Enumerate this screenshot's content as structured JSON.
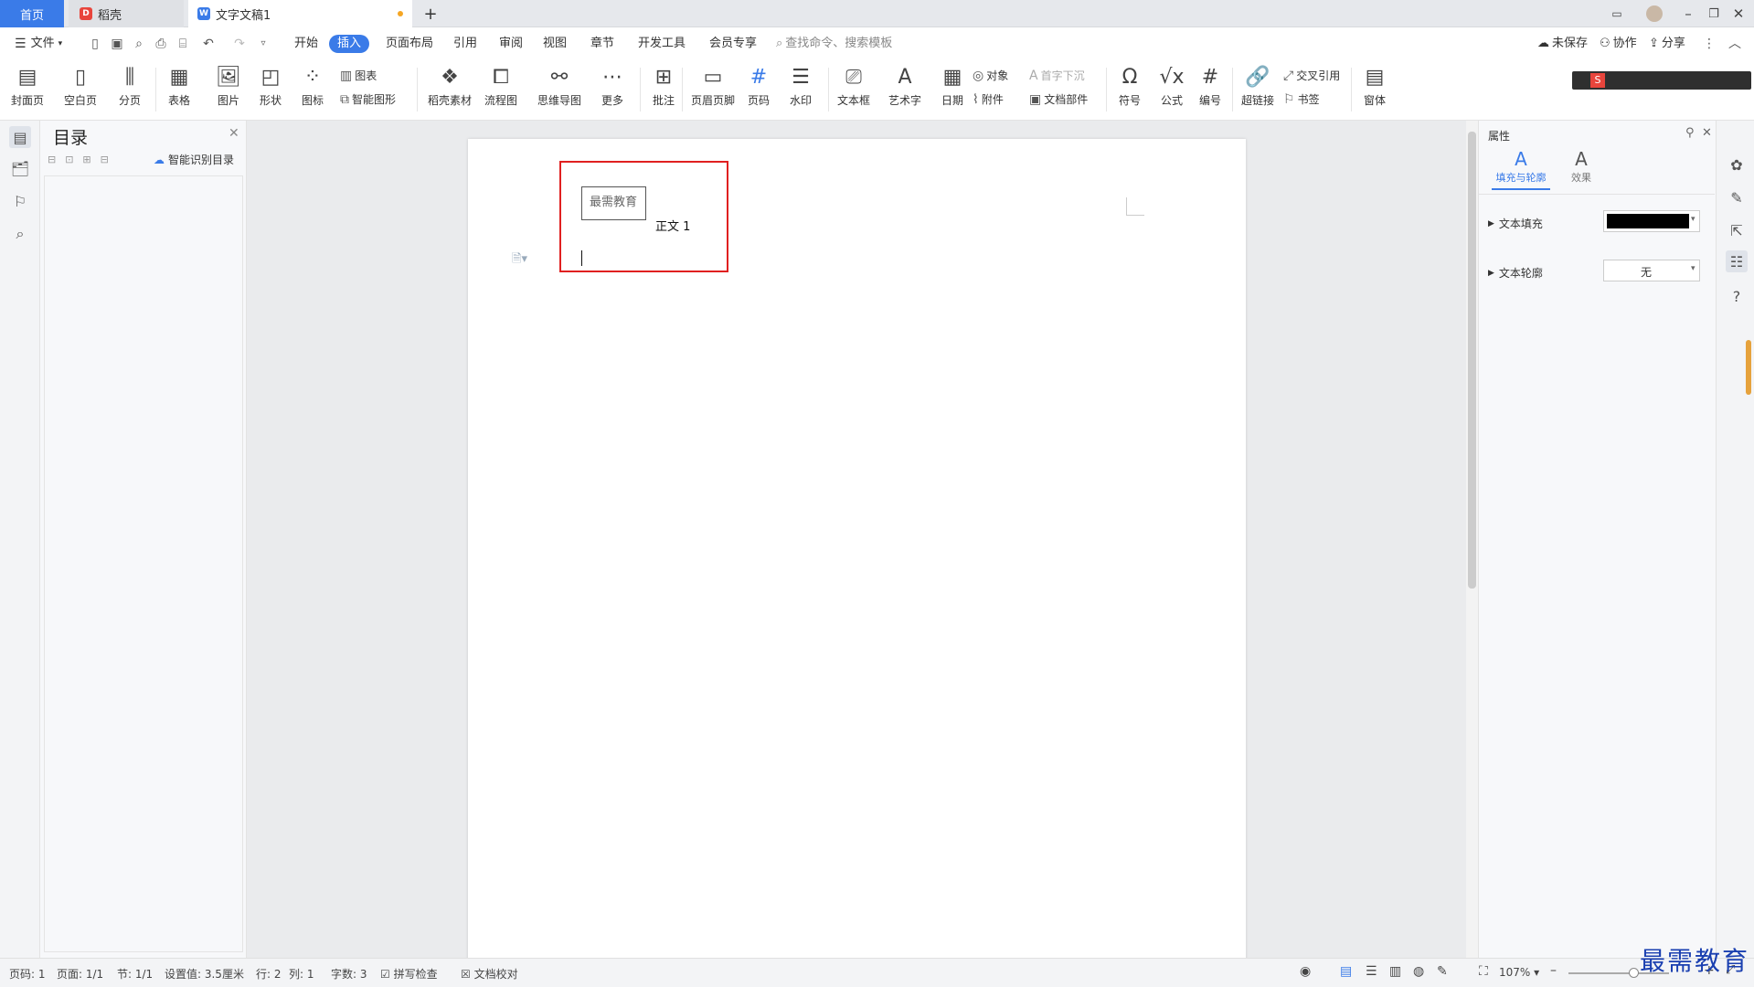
{
  "tabs": {
    "home": "首页",
    "docer": "稻壳",
    "doc": "文字文稿1",
    "add": "+"
  },
  "menu": {
    "file": "文件",
    "items": [
      "开始",
      "插入",
      "页面布局",
      "引用",
      "审阅",
      "视图",
      "章节",
      "开发工具",
      "会员专享"
    ],
    "active_index": 1,
    "search_placeholder": "查找命令、搜索模板",
    "unsaved": "未保存",
    "collab": "协作",
    "share": "分享"
  },
  "ribbon": {
    "cover": "封面页",
    "blank": "空白页",
    "pagebreak": "分页",
    "table": "表格",
    "picture": "图片",
    "shape": "形状",
    "icon": "图标",
    "chart": "图表",
    "smartart": "智能图形",
    "docer_material": "稻壳素材",
    "flowchart": "流程图",
    "mindmap": "思维导图",
    "more": "更多",
    "comment": "批注",
    "header_footer": "页眉页脚",
    "page_number": "页码",
    "watermark": "水印",
    "textbox": "文本框",
    "wordart": "艺术字",
    "date": "日期",
    "object": "对象",
    "attachment": "附件",
    "dropcap": "首字下沉",
    "doc_parts": "文档部件",
    "symbol": "符号",
    "formula": "公式",
    "numbering": "编号",
    "hyperlink": "超链接",
    "crossref": "交叉引用",
    "bookmark": "书签",
    "window": "窗体"
  },
  "toc": {
    "title": "目录",
    "smart": "智能识别目录"
  },
  "document": {
    "textbox_text": "最需教育",
    "body_text": "正文 1"
  },
  "properties": {
    "title": "属性",
    "tab_fill": "填充与轮廓",
    "tab_effect": "效果",
    "text_fill": "文本填充",
    "text_outline": "文本轮廓",
    "outline_value": "无",
    "fill_color": "#000000"
  },
  "status": {
    "page": "页码: 1",
    "pages": "页面: 1/1",
    "section": "节: 1/1",
    "setting": "设置值: 3.5厘米",
    "row": "行: 2",
    "col": "列: 1",
    "words": "字数: 3",
    "spell": "拼写检查",
    "proof": "文档校对",
    "zoom": "107%"
  },
  "watermark": "最需教育",
  "colors": {
    "accent": "#3a7be8",
    "highlight_box": "#e02020"
  }
}
